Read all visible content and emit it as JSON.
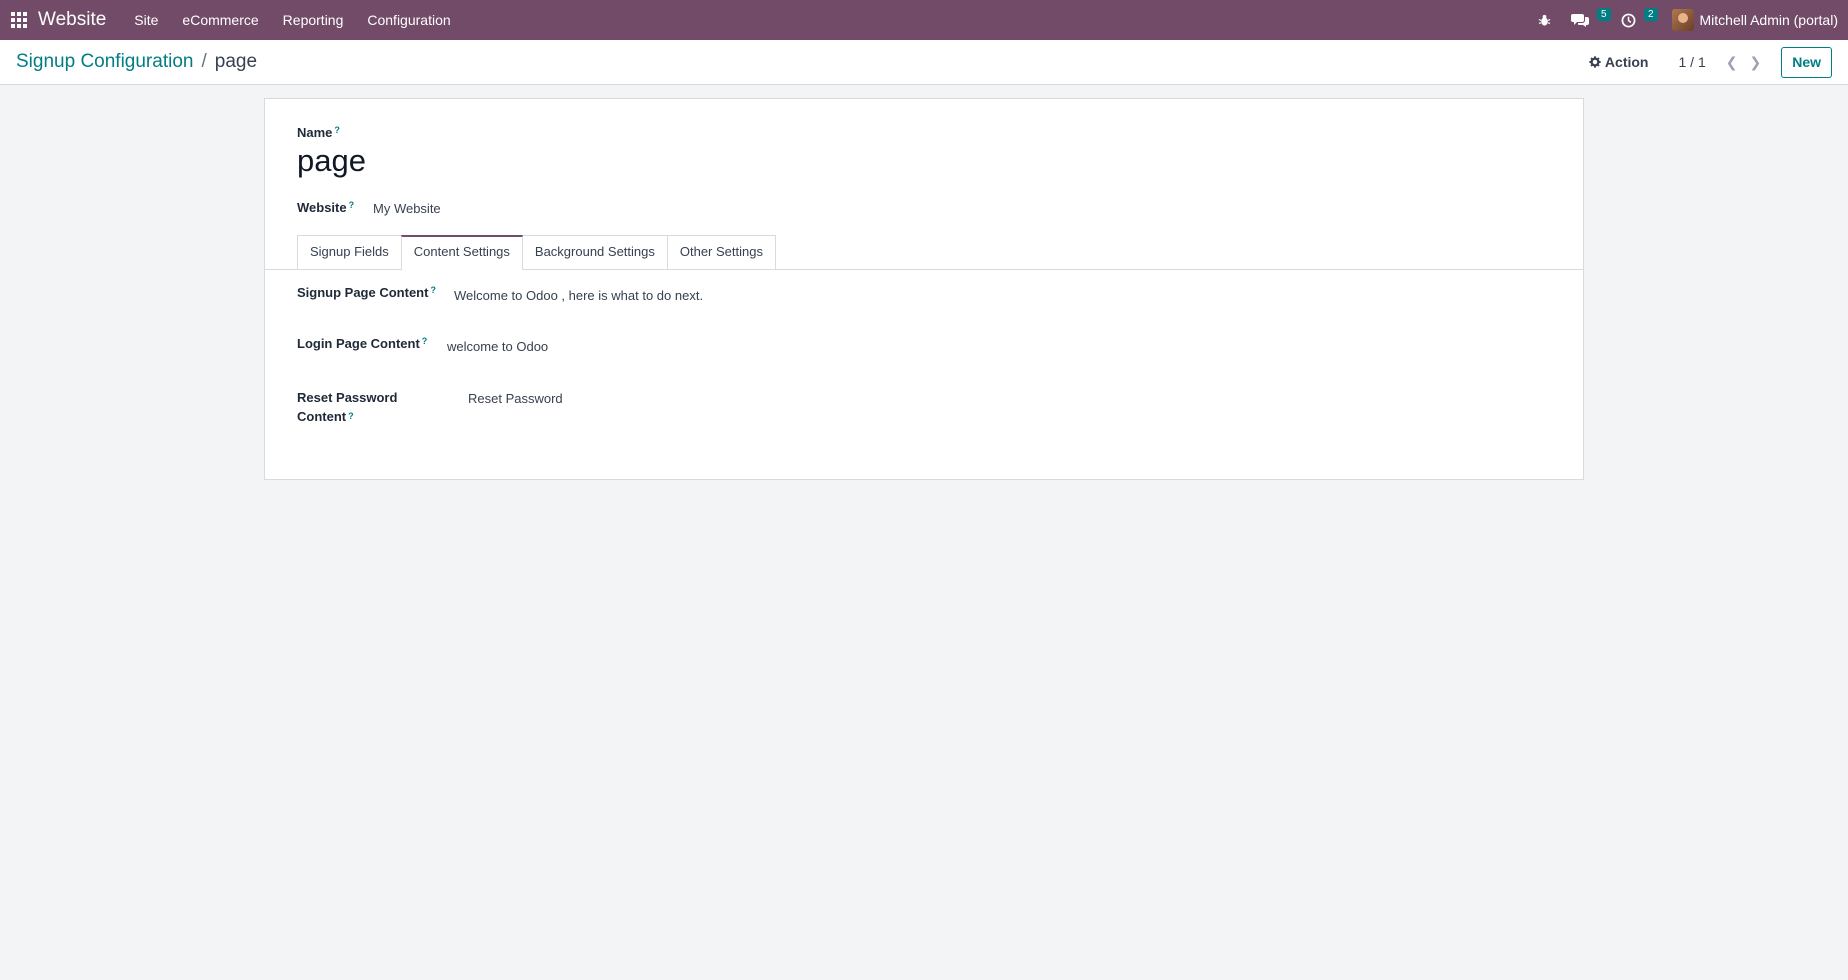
{
  "navbar": {
    "brand": "Website",
    "menu": [
      "Site",
      "eCommerce",
      "Reporting",
      "Configuration"
    ],
    "messages_count": "5",
    "activities_count": "2",
    "user_name": "Mitchell Admin (portal)"
  },
  "control_panel": {
    "breadcrumb_parent": "Signup Configuration",
    "breadcrumb_sep": "/",
    "breadcrumb_current": "page",
    "action_label": "Action",
    "pager": "1 / 1",
    "new_label": "New"
  },
  "form": {
    "name_label": "Name",
    "name_value": "page",
    "website_label": "Website",
    "website_value": "My Website",
    "help_mark": "?",
    "tabs": [
      "Signup Fields",
      "Content Settings",
      "Background Settings",
      "Other Settings"
    ],
    "active_tab": "Content Settings",
    "fields": [
      {
        "label": "Signup Page Content",
        "value": "Welcome to Odoo , here is what to do next."
      },
      {
        "label": "Login Page Content",
        "value": "welcome to Odoo"
      },
      {
        "label_line1": "Reset Password",
        "label_line2": "Content",
        "value": "Reset Password"
      }
    ]
  },
  "colors": {
    "brand": "#714b67",
    "accent": "#017e84",
    "background": "#f3f4f6"
  }
}
